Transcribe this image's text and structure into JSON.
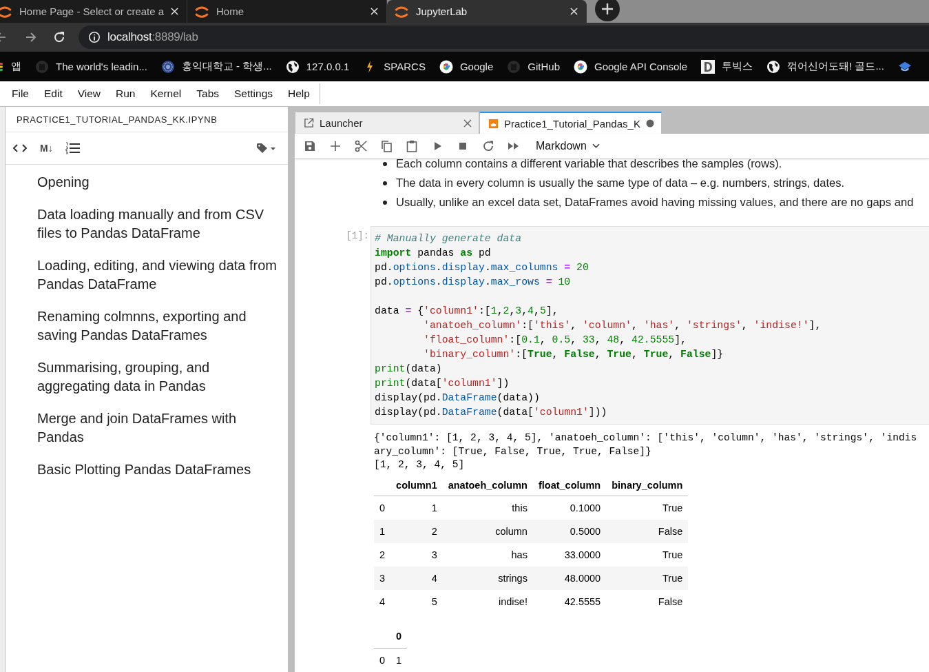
{
  "browser": {
    "tabs": [
      {
        "title": "Home Page - Select or create a",
        "selected": false
      },
      {
        "title": "Home",
        "selected": false
      },
      {
        "title": "JupyterLab",
        "selected": true
      }
    ],
    "address": {
      "host": "localhost",
      "path": ":8889/lab"
    },
    "bookmarks": [
      {
        "kind": "apps",
        "label": "앱"
      },
      {
        "kind": "github",
        "label": "The world's leadin..."
      },
      {
        "kind": "seal",
        "label": "홍익대학교 - 학생..."
      },
      {
        "kind": "globe",
        "label": "127.0.0.1"
      },
      {
        "kind": "bolt",
        "label": "SPARCS"
      },
      {
        "kind": "google",
        "label": "Google"
      },
      {
        "kind": "github",
        "label": "GitHub"
      },
      {
        "kind": "google",
        "label": "Google API Console"
      },
      {
        "kind": "square",
        "label": "투빅스"
      },
      {
        "kind": "globe",
        "label": "꺾어신어도돼! 골드..."
      },
      {
        "kind": "hat"
      }
    ]
  },
  "menu": [
    "File",
    "Edit",
    "View",
    "Run",
    "Kernel",
    "Tabs",
    "Settings",
    "Help"
  ],
  "sidebar": {
    "title": "PRACTICE1_TUTORIAL_PANDAS_KK.IPYNB",
    "markdown_toggle": "M↓",
    "headings": [
      "Opening",
      "Data loading manually and from CSV files to Pandas DataFrame",
      "Loading, editing, and viewing data from Pandas DataFrame",
      "Renaming colmnns, exporting and saving Pandas DataFrames",
      "Summarising, grouping, and aggregating data in Pandas",
      "Merge and join DataFrames with Pandas",
      "Basic Plotting Pandas DataFrames"
    ]
  },
  "notebook": {
    "tabs": [
      {
        "label": "Launcher",
        "selected": false,
        "unsaved": false,
        "kind": "launcher"
      },
      {
        "label": "Practice1_Tutorial_Pandas_K",
        "selected": true,
        "unsaved": true,
        "kind": "notebook"
      }
    ],
    "cell_type": "Markdown",
    "bullets": [
      "Each column contains a different variable that describes the samples (rows).",
      "The data in every column is usually the same type of data – e.g. numbers, strings, dates.",
      "Usually, unlike an excel data set, DataFrames avoid having missing values, and there are no gaps and"
    ],
    "prompt": "[1]:",
    "code": [
      {
        "t": [
          {
            "text": "# Manually generate data",
            "kind": "comment"
          }
        ]
      },
      {
        "t": [
          {
            "text": "import",
            "kind": "keyword"
          },
          {
            "text": " pandas ",
            "kind": "plain"
          },
          {
            "text": "as",
            "kind": "keyword"
          },
          {
            "text": " pd",
            "kind": "plain"
          }
        ]
      },
      {
        "t": [
          {
            "text": "pd.",
            "kind": "plain"
          },
          {
            "text": "options",
            "kind": "attr"
          },
          {
            "text": ".",
            "kind": "plain"
          },
          {
            "text": "display",
            "kind": "attr"
          },
          {
            "text": ".",
            "kind": "plain"
          },
          {
            "text": "max_columns",
            "kind": "attr"
          },
          {
            "text": " = ",
            "kind": "operator"
          },
          {
            "text": "20",
            "kind": "number"
          }
        ]
      },
      {
        "t": [
          {
            "text": "pd.",
            "kind": "plain"
          },
          {
            "text": "options",
            "kind": "attr"
          },
          {
            "text": ".",
            "kind": "plain"
          },
          {
            "text": "display",
            "kind": "attr"
          },
          {
            "text": ".",
            "kind": "plain"
          },
          {
            "text": "max_rows",
            "kind": "attr"
          },
          {
            "text": " = ",
            "kind": "operator"
          },
          {
            "text": "10",
            "kind": "number"
          }
        ]
      },
      {
        "gap": true,
        "t": [
          {
            "text": "data ",
            "kind": "plain"
          },
          {
            "text": "=",
            "kind": "operator"
          },
          {
            "text": " {",
            "kind": "plain"
          },
          {
            "text": "'column1'",
            "kind": "string"
          },
          {
            "text": ":[",
            "kind": "plain"
          },
          {
            "text": "1",
            "kind": "number"
          },
          {
            "text": ",",
            "kind": "plain"
          },
          {
            "text": "2",
            "kind": "number"
          },
          {
            "text": ",",
            "kind": "plain"
          },
          {
            "text": "3",
            "kind": "number"
          },
          {
            "text": ",",
            "kind": "plain"
          },
          {
            "text": "4",
            "kind": "number"
          },
          {
            "text": ",",
            "kind": "plain"
          },
          {
            "text": "5",
            "kind": "number"
          },
          {
            "text": "],",
            "kind": "plain"
          }
        ]
      },
      {
        "t": [
          {
            "text": "        'anatoeh_column'",
            "kind": "string"
          },
          {
            "text": ":[",
            "kind": "plain"
          },
          {
            "text": "'this'",
            "kind": "string"
          },
          {
            "text": ", ",
            "kind": "plain"
          },
          {
            "text": "'column'",
            "kind": "string"
          },
          {
            "text": ", ",
            "kind": "plain"
          },
          {
            "text": "'has'",
            "kind": "string"
          },
          {
            "text": ", ",
            "kind": "plain"
          },
          {
            "text": "'strings'",
            "kind": "string"
          },
          {
            "text": ", ",
            "kind": "plain"
          },
          {
            "text": "'indise!'",
            "kind": "string"
          },
          {
            "text": "],",
            "kind": "plain"
          }
        ]
      },
      {
        "t": [
          {
            "text": "        'float_column'",
            "kind": "string"
          },
          {
            "text": ":[",
            "kind": "plain"
          },
          {
            "text": "0.1",
            "kind": "number"
          },
          {
            "text": ", ",
            "kind": "plain"
          },
          {
            "text": "0.5",
            "kind": "number"
          },
          {
            "text": ", ",
            "kind": "plain"
          },
          {
            "text": "33",
            "kind": "number"
          },
          {
            "text": ", ",
            "kind": "plain"
          },
          {
            "text": "48",
            "kind": "number"
          },
          {
            "text": ", ",
            "kind": "plain"
          },
          {
            "text": "42.5555",
            "kind": "number"
          },
          {
            "text": "],",
            "kind": "plain"
          }
        ]
      },
      {
        "t": [
          {
            "text": "        'binary_column'",
            "kind": "string"
          },
          {
            "text": ":[",
            "kind": "plain"
          },
          {
            "text": "True",
            "kind": "keyword"
          },
          {
            "text": ", ",
            "kind": "plain"
          },
          {
            "text": "False",
            "kind": "keyword"
          },
          {
            "text": ", ",
            "kind": "plain"
          },
          {
            "text": "True",
            "kind": "keyword"
          },
          {
            "text": ", ",
            "kind": "plain"
          },
          {
            "text": "True",
            "kind": "keyword"
          },
          {
            "text": ", ",
            "kind": "plain"
          },
          {
            "text": "False",
            "kind": "keyword"
          },
          {
            "text": "]}",
            "kind": "plain"
          }
        ]
      },
      {
        "t": [
          {
            "text": "print",
            "kind": "builtin"
          },
          {
            "text": "(data)",
            "kind": "plain"
          }
        ]
      },
      {
        "t": [
          {
            "text": "print",
            "kind": "builtin"
          },
          {
            "text": "(data[",
            "kind": "plain"
          },
          {
            "text": "'column1'",
            "kind": "string"
          },
          {
            "text": "])",
            "kind": "plain"
          }
        ]
      },
      {
        "t": [
          {
            "text": "display(pd.",
            "kind": "plain"
          },
          {
            "text": "DataFrame",
            "kind": "attr"
          },
          {
            "text": "(data))",
            "kind": "plain"
          }
        ]
      },
      {
        "t": [
          {
            "text": "display(pd.",
            "kind": "plain"
          },
          {
            "text": "DataFrame",
            "kind": "attr"
          },
          {
            "text": "(data[",
            "kind": "plain"
          },
          {
            "text": "'column1'",
            "kind": "string"
          },
          {
            "text": "]))",
            "kind": "plain"
          }
        ]
      }
    ],
    "stream": [
      "{'column1': [1, 2, 3, 4, 5], 'anatoeh_column': ['this', 'column', 'has', 'strings', 'indis",
      "ary_column': [True, False, True, True, False]}",
      "[1, 2, 3, 4, 5]"
    ],
    "tables": [
      {
        "columns": [
          null,
          "column1",
          "anatoeh_column",
          "float_column",
          "binary_column"
        ],
        "rows": [
          [
            "0",
            "1",
            "this",
            "0.1000",
            "True"
          ],
          [
            "1",
            "2",
            "column",
            "0.5000",
            "False"
          ],
          [
            "2",
            "3",
            "has",
            "33.0000",
            "True"
          ],
          [
            "3",
            "4",
            "strings",
            "48.0000",
            "True"
          ],
          [
            "4",
            "5",
            "indise!",
            "42.5555",
            "False"
          ]
        ]
      },
      {
        "columns": [
          null,
          "0"
        ],
        "rows": [
          [
            "0",
            "1"
          ]
        ]
      }
    ]
  }
}
